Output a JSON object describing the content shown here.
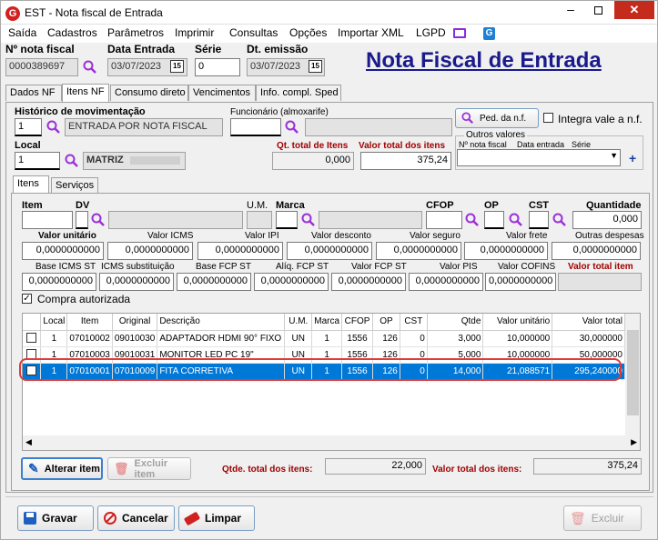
{
  "window": {
    "title": "EST - Nota fiscal de Entrada",
    "logo": "G"
  },
  "menu": [
    "Saída",
    "Cadastros",
    "Parâmetros",
    "Imprimir",
    "Consultas",
    "Opções",
    "Importar XML",
    "LGPD"
  ],
  "header": {
    "nf_label": "Nº nota fiscal",
    "nf_value": "0000389697",
    "data_label": "Data Entrada",
    "data_value": "03/07/2023",
    "serie_label": "Série",
    "serie_value": "0",
    "emissao_label": "Dt. emissão",
    "emissao_value": "03/07/2023",
    "cal_glyph": "15",
    "big_title": "Nota Fiscal de Entrada"
  },
  "tabs": [
    "Dados NF",
    "Itens NF",
    "Consumo direto",
    "Vencimentos",
    "Info. compl. Sped"
  ],
  "itens": {
    "hist_label": "Histórico de movimentação",
    "hist_code": "1",
    "hist_desc": "ENTRADA POR NOTA FISCAL",
    "func_label": "Funcionário (almoxarife)",
    "ped_button": "Ped. da n.f.",
    "integra_label": "Integra vale a n.f.",
    "local_label": "Local",
    "local_code": "1",
    "local_desc": "MATRIZ",
    "qt_label": "Qt. total de Itens",
    "qt_value": "0,000",
    "vt_label": "Valor total dos itens",
    "vt_value": "375,24",
    "outros_label": "Outros valores",
    "outros_cols": [
      "Nº nota fiscal",
      "Data entrada",
      "Série"
    ],
    "plus": "+"
  },
  "subtabs": [
    "Itens",
    "Serviços"
  ],
  "row1": {
    "item": "Item",
    "dv": "DV",
    "um": "U.M.",
    "marca": "Marca",
    "cfop": "CFOP",
    "op": "OP",
    "cst": "CST",
    "quantidade": "Quantidade",
    "quantidade_value": "0,000"
  },
  "row2": {
    "labels": [
      "Valor unitário",
      "Valor ICMS",
      "Valor IPI",
      "Valor desconto",
      "Valor seguro",
      "Valor frete",
      "Outras despesas"
    ],
    "values": [
      "0,0000000000",
      "0,0000000000",
      "0,0000000000",
      "0,0000000000",
      "0,0000000000",
      "0,0000000000",
      "0,0000000000"
    ]
  },
  "row3": {
    "labels": [
      "Base ICMS ST",
      "ICMS substituição",
      "Base FCP ST",
      "Alíq. FCP ST",
      "Valor FCP ST",
      "Valor PIS",
      "Valor COFINS",
      "Valor total item"
    ],
    "values": [
      "0,0000000000",
      "0,0000000000",
      "0,0000000000",
      "0,0000000000",
      "0,0000000000",
      "0,0000000000",
      "0,0000000000",
      ""
    ]
  },
  "compra_autorizada": "Compra autorizada",
  "grid": {
    "columns": [
      "",
      "Local",
      "Item",
      "Original",
      "Descrição",
      "U.M.",
      "Marca",
      "CFOP",
      "OP",
      "CST",
      "Qtde",
      "Valor unitário",
      "Valor total"
    ],
    "rows": [
      [
        "",
        "1",
        "07010002",
        "09010030",
        "ADAPTADOR HDMI 90° FIXO",
        "UN",
        "1",
        "1556",
        "126",
        "0",
        "3,000",
        "10,000000",
        "30,000000"
      ],
      [
        "",
        "1",
        "07010003",
        "09010031",
        "MONITOR LED PC 19\"",
        "UN",
        "1",
        "1556",
        "126",
        "0",
        "5,000",
        "10,000000",
        "50,000000"
      ],
      [
        "",
        "1",
        "07010001",
        "07010009",
        "FITA CORRETIVA",
        "UN",
        "1",
        "1556",
        "126",
        "0",
        "14,000",
        "21,088571",
        "295,240000"
      ]
    ],
    "selected_row": 2
  },
  "bottom": {
    "alterar": "Alterar item",
    "excluir": "Excluir item",
    "qtde_label": "Qtde. total dos itens:",
    "qtde_value": "22,000",
    "valor_label": "Valor total dos itens:",
    "valor_value": "375,24"
  },
  "footer": {
    "gravar": "Gravar",
    "cancelar": "Cancelar",
    "limpar": "Limpar",
    "excluir": "Excluir"
  }
}
